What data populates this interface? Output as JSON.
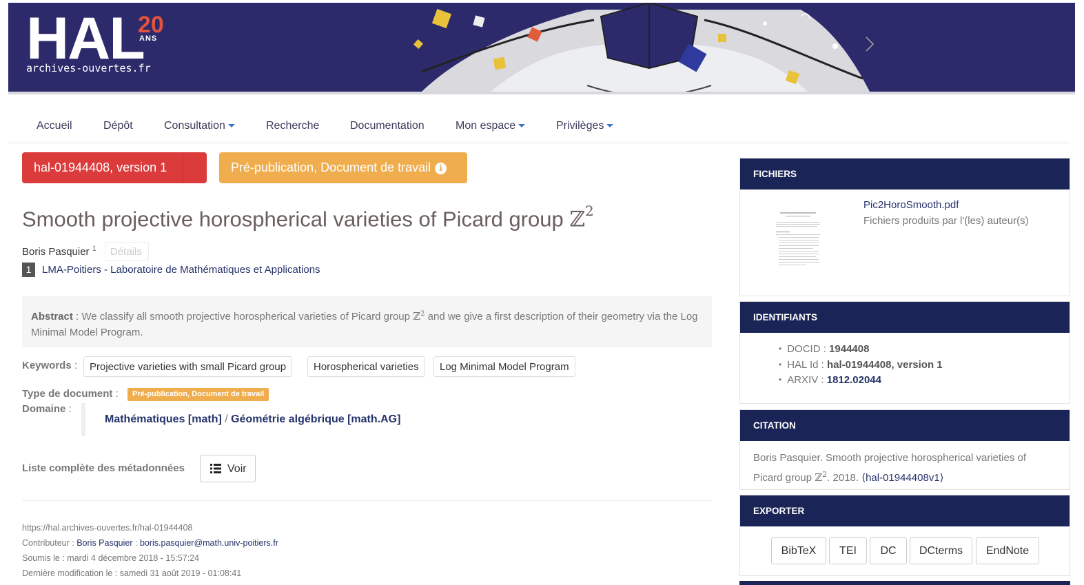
{
  "banner": {
    "logo": "HAL",
    "logo_badge_number": "20",
    "logo_badge_word": "ANS",
    "logo_subtitle": "archives-ouvertes.fr"
  },
  "nav": {
    "items": [
      {
        "label": "Accueil",
        "dropdown": false
      },
      {
        "label": "Dépôt",
        "dropdown": false
      },
      {
        "label": "Consultation",
        "dropdown": true
      },
      {
        "label": "Recherche",
        "dropdown": false
      },
      {
        "label": "Documentation",
        "dropdown": false
      },
      {
        "label": "Mon espace",
        "dropdown": true
      },
      {
        "label": "Privilèges",
        "dropdown": true
      }
    ]
  },
  "document": {
    "version_label": "hal-01944408, version 1",
    "type_button_label": "Pré-publication, Document de travail",
    "title_text": "Smooth projective horospherical varieties of Picard group ",
    "title_symbol": "ℤ",
    "title_exponent": "2",
    "author": "Boris Pasquier",
    "author_affil_ref": "1",
    "details_label": "Détails",
    "affiliation_number": "1",
    "affiliation": "LMA-Poitiers - Laboratoire de Mathématiques et Applications",
    "abstract_label": "Abstract",
    "abstract_sep": " : ",
    "abstract_part1": "We classify all smooth projective horospherical varieties of Picard group ",
    "abstract_symbol": "ℤ",
    "abstract_exponent": "2",
    "abstract_part2": " and we give a first description of their geometry via the Log Minimal Model Program.",
    "keywords_label": "Keywords",
    "keywords": [
      "Projective varieties with small Picard group",
      "Horospherical varieties",
      "Log Minimal Model Program"
    ],
    "doctype_label": "Type de document",
    "doctype_value": "Pré-publication, Document de travail",
    "domaine_label": "Domaine",
    "domaine_part1": "Mathématiques [math]",
    "domaine_sep": " / ",
    "domaine_part2": "Géométrie algébrique [math.AG]",
    "metadata_label": "Liste complète des métadonnées",
    "voir_label": "Voir",
    "colon": " :"
  },
  "footer": {
    "url": "https://hal.archives-ouvertes.fr/hal-01944408",
    "contributor_label": "Contributeur : ",
    "contributor_name": "Boris Pasquier",
    "contributor_sep": " : ",
    "contributor_email": "boris.pasquier@math.univ-poitiers.fr",
    "submitted": "Soumis le : mardi 4 décembre 2018 - 15:57:24",
    "modified": "Dernière modification le : samedi 31 août 2019 - 01:08:41"
  },
  "sidebar": {
    "files": {
      "heading": "FICHIERS",
      "file_name": "Pic2HoroSmooth.pdf",
      "file_desc": "Fichiers produits par l'(les) auteur(s)"
    },
    "identifiers": {
      "heading": "IDENTIFIANTS",
      "items": [
        {
          "label": "DOCID : ",
          "value": "1944408"
        },
        {
          "label": "HAL Id : ",
          "value": "hal-01944408, version 1"
        },
        {
          "label": "ARXIV : ",
          "value": "1812.02044"
        }
      ]
    },
    "citation": {
      "heading": "CITATION",
      "text1": "Boris Pasquier. Smooth projective horospherical varieties of Picard group ",
      "symbol": "ℤ",
      "exponent": "2",
      "text2": ". 2018. ",
      "link": "⟨hal-01944408v1⟩"
    },
    "export": {
      "heading": "EXPORTER",
      "buttons": [
        "BibTeX",
        "TEI",
        "DC",
        "DCterms",
        "EndNote"
      ]
    }
  },
  "colors": {
    "banner": "#2c2a6b",
    "version_button": "#dc3b3b",
    "type_button": "#f0ad4e",
    "panel_header": "#1a2456",
    "link": "#26336b",
    "logo_accent": "#e0533e"
  }
}
